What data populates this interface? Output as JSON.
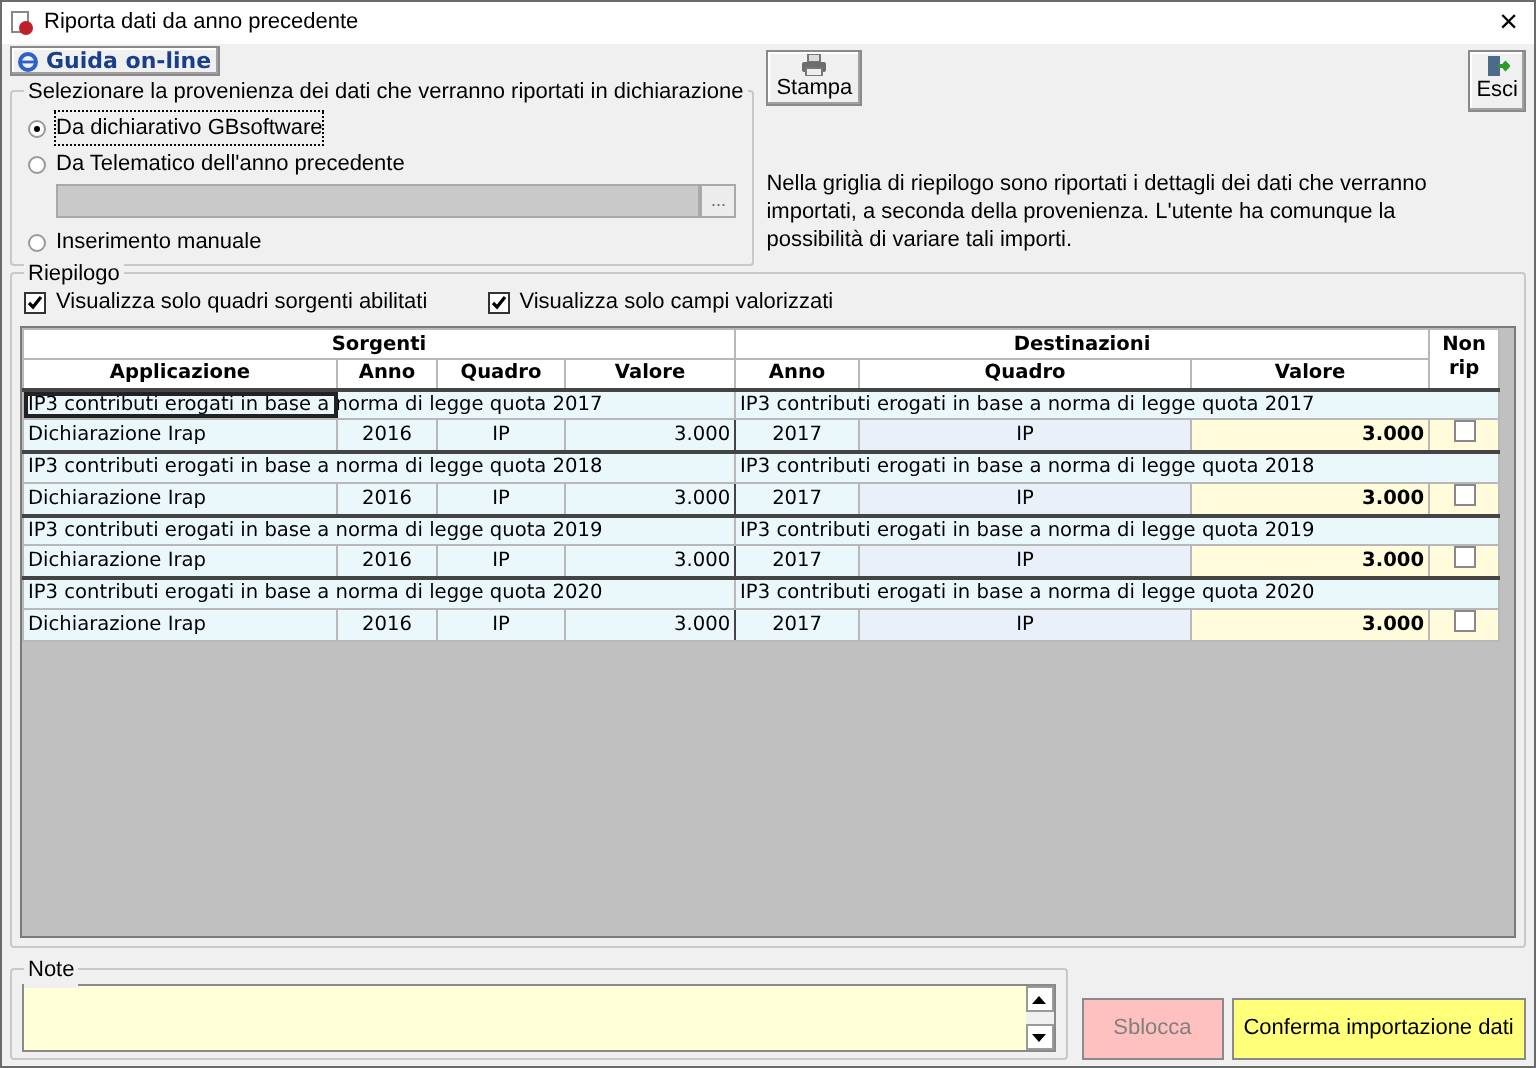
{
  "window": {
    "title": "Riporta dati da anno precedente",
    "close_glyph": "×"
  },
  "toolbar": {
    "help_button": "Guida on-line",
    "print_button": "Stampa",
    "exit_button": "Esci"
  },
  "source_group": {
    "legend": "Selezionare la provenienza dei dati che verranno riportati in dichiarazione",
    "options": [
      {
        "kind": "radio",
        "label": "Da dichiarativo GBsoftware",
        "selected": true
      },
      {
        "kind": "radio",
        "label": "Da Telematico dell'anno precedente",
        "selected": false
      },
      {
        "kind": "file",
        "browse_button": "...",
        "disabled": true
      },
      {
        "kind": "radio",
        "label": "Inserimento manuale",
        "selected": false
      }
    ]
  },
  "info_text": "Nella griglia di riepilogo sono riportati i dettagli dei dati che verranno importati, a seconda della provenienza. L'utente ha comunque la possibilità di variare tali importi.",
  "summary": {
    "legend": "Riepilogo",
    "filters": [
      {
        "label": "Visualizza solo quadri sorgenti abilitati",
        "checked": true
      },
      {
        "label": "Visualizza solo campi valorizzati",
        "checked": true
      }
    ],
    "table": {
      "group_headers": [
        "Sorgenti",
        "Destinazioni"
      ],
      "columns": [
        "Applicazione",
        "Anno",
        "Quadro",
        "Valore",
        "Anno",
        "Quadro",
        "Valore",
        "Non rip"
      ],
      "rows": [
        {
          "source_description": "IP3 contributi erogati in base a norma di legge quota 2017",
          "dest_description": "IP3 contributi erogati in base a norma di legge quota 2017",
          "application": "Dichiarazione Irap",
          "source_year": "2016",
          "source_frame": "IP",
          "source_value": "3.000",
          "dest_year": "2017",
          "dest_frame": "IP",
          "dest_value": "3.000",
          "not_carried": false,
          "focused": true
        },
        {
          "source_description": "IP3 contributi erogati in base a norma di legge quota 2018",
          "dest_description": "IP3 contributi erogati in base a norma di legge quota 2018",
          "application": "Dichiarazione Irap",
          "source_year": "2016",
          "source_frame": "IP",
          "source_value": "3.000",
          "dest_year": "2017",
          "dest_frame": "IP",
          "dest_value": "3.000",
          "not_carried": false,
          "focused": false
        },
        {
          "source_description": "IP3 contributi erogati in base a norma di legge quota 2019",
          "dest_description": "IP3 contributi erogati in base a norma di legge quota 2019",
          "application": "Dichiarazione Irap",
          "source_year": "2016",
          "source_frame": "IP",
          "source_value": "3.000",
          "dest_year": "2017",
          "dest_frame": "IP",
          "dest_value": "3.000",
          "not_carried": false,
          "focused": false
        },
        {
          "source_description": "IP3 contributi erogati in base a norma di legge quota 2020",
          "dest_description": "IP3 contributi erogati in base a norma di legge quota 2020",
          "application": "Dichiarazione Irap",
          "source_year": "2016",
          "source_frame": "IP",
          "source_value": "3.000",
          "dest_year": "2017",
          "dest_frame": "IP",
          "dest_value": "3.000",
          "not_carried": false,
          "focused": false
        }
      ]
    }
  },
  "note": {
    "legend": "Note"
  },
  "actions": [
    {
      "kind": "unlock",
      "label": "Sblocca",
      "disabled": true
    },
    {
      "kind": "confirm",
      "label": "Conferma importazione dati",
      "disabled": false
    }
  ]
}
